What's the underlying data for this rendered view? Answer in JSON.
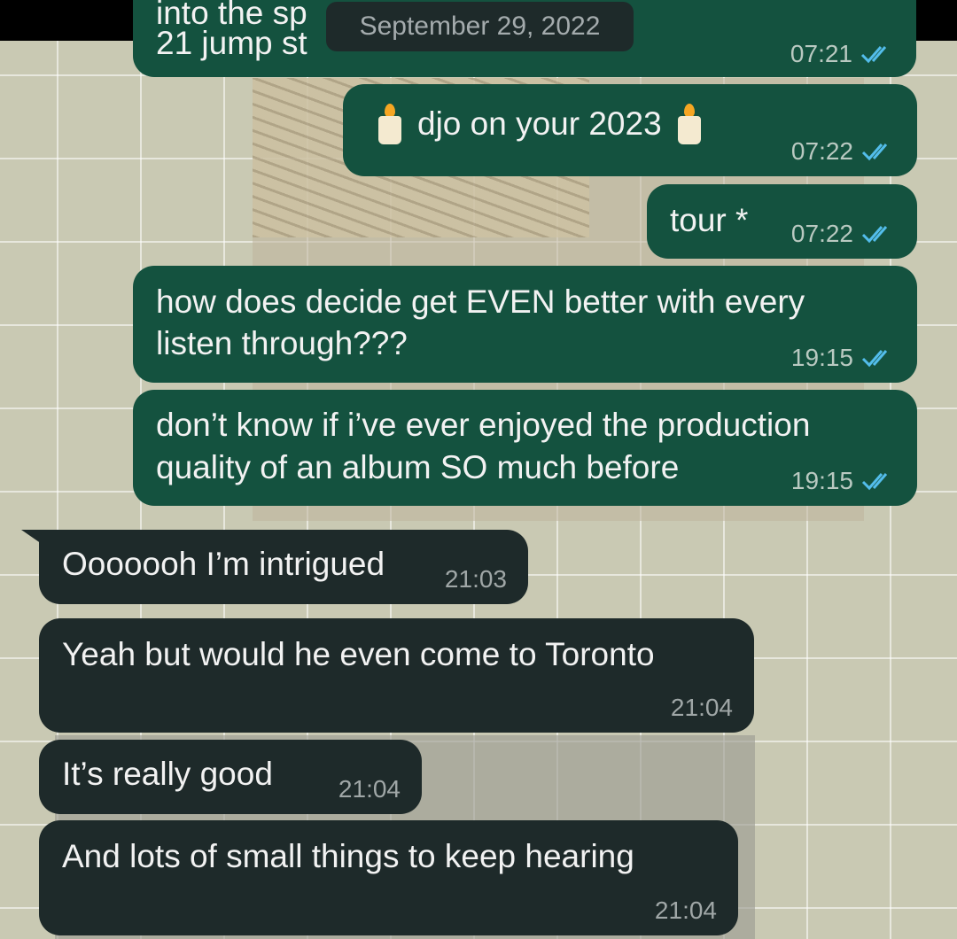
{
  "date_divider": "September 29, 2022",
  "messages": [
    {
      "dir": "out",
      "lines": [
        "into the sp",
        "21 jump st"
      ],
      "time": "07:21"
    },
    {
      "dir": "out",
      "lines": [
        "djo on your 2023"
      ],
      "time": "07:22"
    },
    {
      "dir": "out",
      "lines": [
        "tour *"
      ],
      "time": "07:22"
    },
    {
      "dir": "out",
      "lines": [
        "how does decide get EVEN better with every",
        "listen through???"
      ],
      "time": "19:15"
    },
    {
      "dir": "out",
      "lines": [
        "don’t know if i’ve ever enjoyed the production",
        "quality of an album SO much before"
      ],
      "time": "19:15"
    },
    {
      "dir": "in",
      "lines": [
        "Ooooooh I’m intrigued"
      ],
      "time": "21:03"
    },
    {
      "dir": "in",
      "lines": [
        "Yeah but would he even come to Toronto"
      ],
      "time": "21:04"
    },
    {
      "dir": "in",
      "lines": [
        "It’s really good"
      ],
      "time": "21:04"
    },
    {
      "dir": "in",
      "lines": [
        "And lots of small things to keep hearing"
      ],
      "time": "21:04"
    }
  ],
  "icons": {
    "read_receipt": "double-check-icon",
    "emoji": "candle-icon"
  },
  "colors": {
    "outgoing_bubble": "#14523f",
    "incoming_bubble": "#1e2a2a",
    "read_tick": "#53bdeb"
  }
}
